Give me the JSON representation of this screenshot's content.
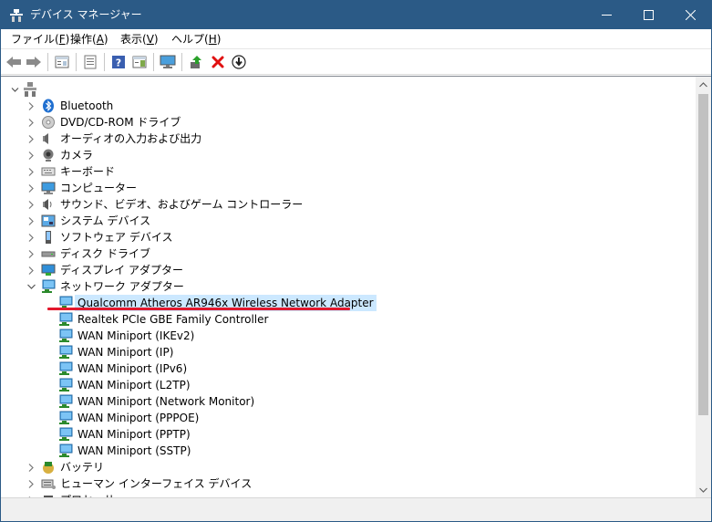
{
  "window": {
    "title": "デバイス マネージャー"
  },
  "menu": [
    {
      "text": "ファイル(",
      "key": "F",
      "tail": ")"
    },
    {
      "text": "操作(",
      "key": "A",
      "tail": ")"
    },
    {
      "text": "表示(",
      "key": "V",
      "tail": ")"
    },
    {
      "text": "ヘルプ(",
      "key": "H",
      "tail": ")"
    }
  ],
  "toolbar_icons": [
    "back-icon",
    "forward-icon",
    "properties-view-icon",
    "device-list-icon",
    "help-icon",
    "action-view-icon",
    "monitor-icon",
    "update-driver-icon",
    "uninstall-icon",
    "scan-hardware-icon"
  ],
  "tree": {
    "categories_before": [
      {
        "label": "Bluetooth",
        "icon": "bluetooth-icon"
      },
      {
        "label": "DVD/CD-ROM ドライブ",
        "icon": "dvd-drive-icon"
      },
      {
        "label": "オーディオの入力および出力",
        "icon": "speaker-icon"
      },
      {
        "label": "カメラ",
        "icon": "camera-icon"
      },
      {
        "label": "キーボード",
        "icon": "keyboard-icon"
      },
      {
        "label": "コンピューター",
        "icon": "computer-icon"
      },
      {
        "label": "サウンド、ビデオ、およびゲーム コントローラー",
        "icon": "sound-icon"
      },
      {
        "label": "システム デバイス",
        "icon": "system-device-icon"
      },
      {
        "label": "ソフトウェア デバイス",
        "icon": "software-device-icon"
      },
      {
        "label": "ディスク ドライブ",
        "icon": "disk-drive-icon"
      },
      {
        "label": "ディスプレイ アダプター",
        "icon": "display-adapter-icon"
      }
    ],
    "network_category": {
      "label": "ネットワーク アダプター",
      "icon": "network-adapter-icon"
    },
    "network_children": [
      {
        "label": "Qualcomm Atheros AR946x Wireless Network Adapter",
        "selected": true
      },
      {
        "label": "Realtek PCIe GBE Family Controller"
      },
      {
        "label": "WAN Miniport (IKEv2)"
      },
      {
        "label": "WAN Miniport (IP)"
      },
      {
        "label": "WAN Miniport (IPv6)"
      },
      {
        "label": "WAN Miniport (L2TP)"
      },
      {
        "label": "WAN Miniport (Network Monitor)"
      },
      {
        "label": "WAN Miniport (PPPOE)"
      },
      {
        "label": "WAN Miniport (PPTP)"
      },
      {
        "label": "WAN Miniport (SSTP)"
      }
    ],
    "categories_after": [
      {
        "label": "バッテリ",
        "icon": "battery-icon"
      },
      {
        "label": "ヒューマン インターフェイス デバイス",
        "icon": "hid-icon"
      },
      {
        "label": "プロセッサ",
        "icon": "processor-icon"
      }
    ]
  },
  "colors": {
    "titlebar": "#2b5a86",
    "selection": "#cce8ff",
    "annotation": "#e3182d"
  }
}
